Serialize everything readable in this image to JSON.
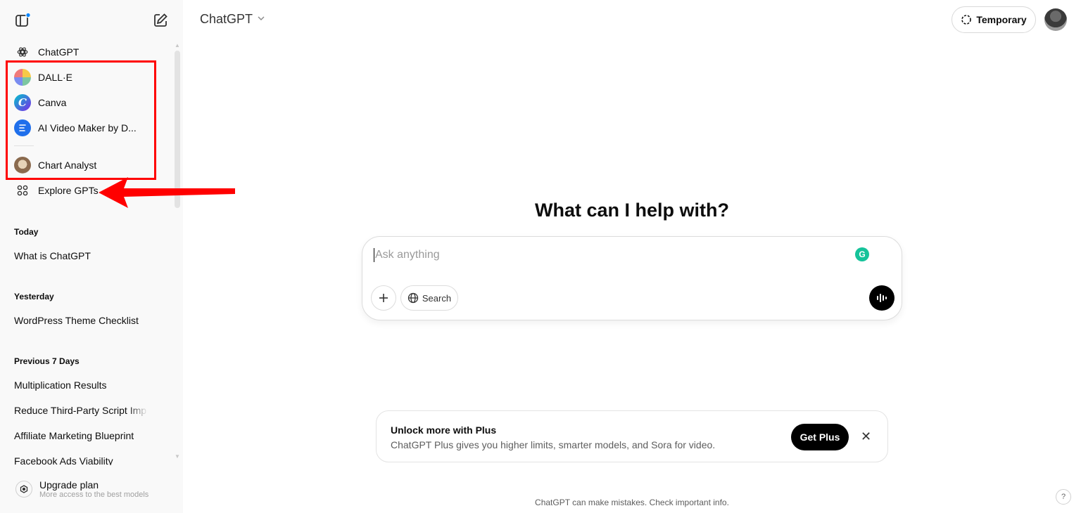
{
  "sidebar": {
    "icons": {
      "toggle": "sidebar-toggle-icon",
      "new_chat": "new-chat-icon"
    },
    "gpts": [
      {
        "label": "ChatGPT",
        "icon": "openai-logo-icon"
      },
      {
        "label": "DALL·E",
        "icon": "dalle-icon"
      },
      {
        "label": "Canva",
        "icon": "canva-icon"
      },
      {
        "label": "AI Video Maker by D...",
        "icon": "video-maker-icon"
      },
      {
        "label": "Chart Analyst",
        "icon": "chart-analyst-avatar"
      },
      {
        "label": "Explore GPTs",
        "icon": "explore-grid-icon"
      }
    ],
    "sections": [
      {
        "heading": "Today",
        "items": [
          "What is ChatGPT"
        ]
      },
      {
        "heading": "Yesterday",
        "items": [
          "WordPress Theme Checklist"
        ]
      },
      {
        "heading": "Previous 7 Days",
        "items": [
          "Multiplication Results",
          "Reduce Third-Party Script Imp",
          "Affiliate Marketing Blueprint",
          "Facebook Ads Viability"
        ]
      }
    ],
    "upgrade": {
      "title": "Upgrade plan",
      "subtitle": "More access to the best models"
    }
  },
  "header": {
    "model": "ChatGPT",
    "temporary_label": "Temporary"
  },
  "main": {
    "headline": "What can I help with?",
    "composer": {
      "placeholder": "Ask anything",
      "search_label": "Search"
    },
    "banner": {
      "title": "Unlock more with Plus",
      "description": "ChatGPT Plus gives you higher limits, smarter models, and Sora for video.",
      "button": "Get Plus",
      "close": "✕"
    },
    "footer": "ChatGPT can make mistakes. Check important info.",
    "help": "?"
  },
  "colors": {
    "annotation": "#ff0000",
    "accent_dot": "#0285ff",
    "grammarly": "#15c39a"
  }
}
